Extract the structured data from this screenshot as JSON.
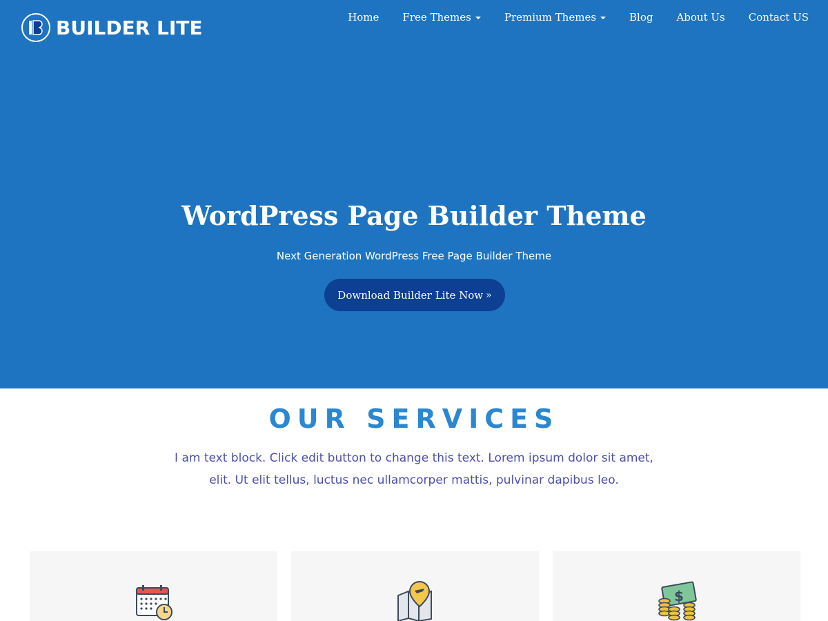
{
  "brand": {
    "name": "BUILDER LITE",
    "logo_letter": "B"
  },
  "nav": {
    "items": [
      {
        "label": "Home",
        "has_dropdown": false
      },
      {
        "label": "Free Themes",
        "has_dropdown": true
      },
      {
        "label": "Premium Themes",
        "has_dropdown": true
      },
      {
        "label": "Blog",
        "has_dropdown": false
      },
      {
        "label": "About Us",
        "has_dropdown": false
      },
      {
        "label": "Contact US",
        "has_dropdown": false
      }
    ]
  },
  "hero": {
    "title": "WordPress Page Builder Theme",
    "subtitle": "Next Generation WordPress Free Page Builder Theme",
    "cta_label": "Download Builder Lite Now",
    "cta_icon": "double-chevron-right-icon"
  },
  "services": {
    "title": "OUR SERVICES",
    "description": "I am text block. Click edit button to change this text. Lorem ipsum dolor sit amet, elit. Ut elit tellus, luctus nec ullamcorper mattis, pulvinar dapibus leo.",
    "cards": [
      {
        "icon": "calendar-clock-icon"
      },
      {
        "icon": "map-location-icon"
      },
      {
        "icon": "money-coins-icon"
      }
    ]
  },
  "colors": {
    "hero_background": "#1e74c0",
    "button_background": "#0d3f92",
    "services_title": "#2a87d0",
    "services_text": "#4c4fae",
    "card_background": "#f6f6f6"
  }
}
